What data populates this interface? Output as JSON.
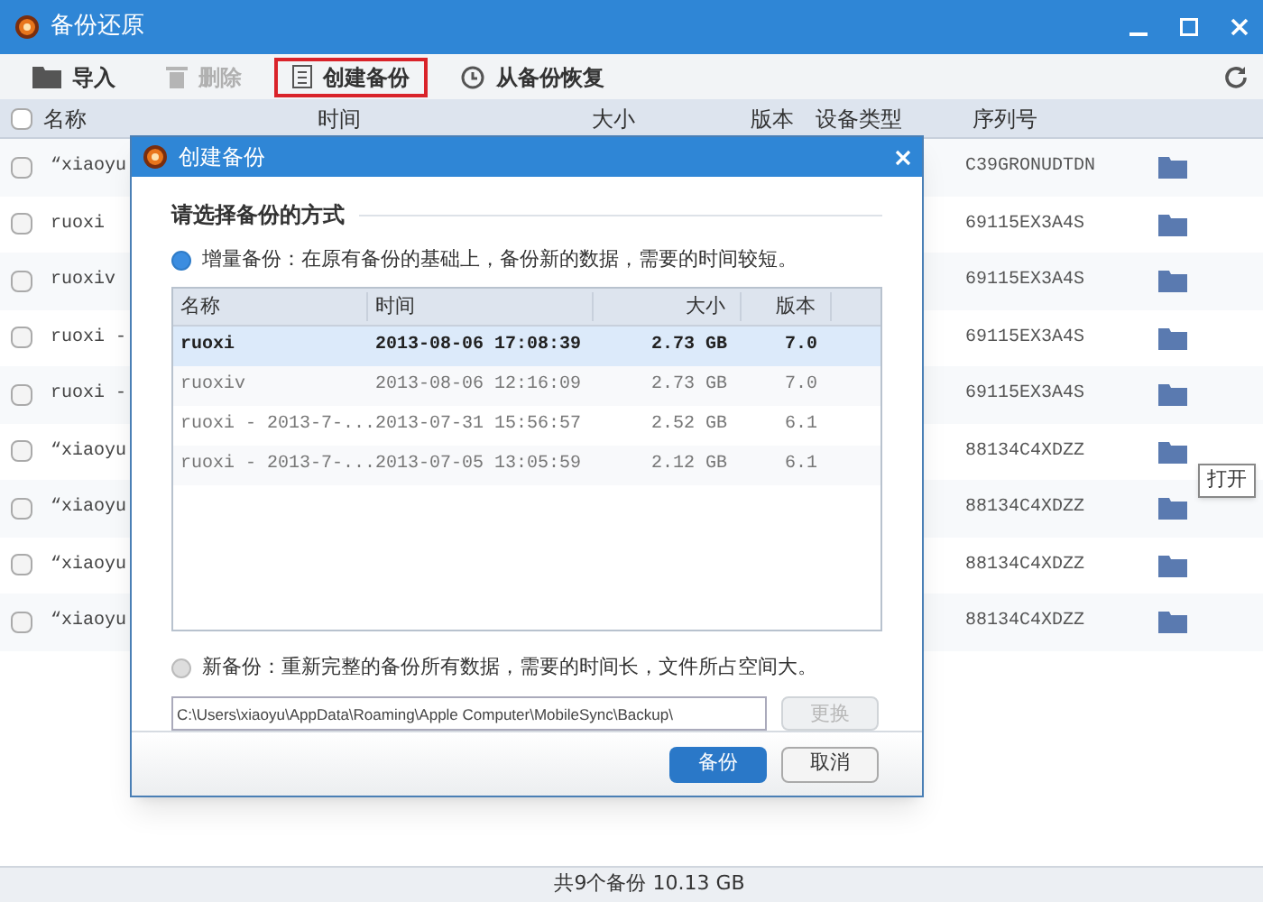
{
  "window": {
    "title": "备份还原"
  },
  "toolbar": [
    {
      "label": "导入",
      "kind": "import",
      "disabled": false,
      "highlighted": false
    },
    {
      "label": "删除",
      "kind": "delete",
      "disabled": true,
      "highlighted": false
    },
    {
      "label": "创建备份",
      "kind": "create",
      "disabled": false,
      "highlighted": true
    },
    {
      "label": "从备份恢复",
      "kind": "restore",
      "disabled": false,
      "highlighted": false
    }
  ],
  "table": {
    "all_checked": false,
    "columns": [
      "名称",
      "时间",
      "大小",
      "版本",
      "设备类型",
      "序列号"
    ],
    "rows": [
      {
        "name": "“xiaoyu",
        "serial": "C39GRONUDTDN",
        "checked": false
      },
      {
        "name": "ruoxi",
        "serial": "69115EX3A4S",
        "checked": false
      },
      {
        "name": "ruoxiv",
        "serial": "69115EX3A4S",
        "checked": false
      },
      {
        "name": "ruoxi -",
        "serial": "69115EX3A4S",
        "checked": false
      },
      {
        "name": "ruoxi -",
        "serial": "69115EX3A4S",
        "checked": false
      },
      {
        "name": "“xiaoyu",
        "serial": "88134C4XDZZ",
        "checked": false
      },
      {
        "name": "“xiaoyu",
        "serial": "88134C4XDZZ",
        "checked": false
      },
      {
        "name": "“xiaoyu",
        "serial": "88134C4XDZZ",
        "checked": false
      },
      {
        "name": "“xiaoyu",
        "serial": "88134C4XDZZ",
        "checked": false
      }
    ]
  },
  "tooltip": "打开",
  "status_bar": "共9个备份 10.13 GB",
  "dialog": {
    "title": "创建备份",
    "heading": "请选择备份的方式",
    "options": [
      {
        "label": "增量备份：在原有备份的基础上，备份新的数据，需要的时间较短。",
        "selected": true
      },
      {
        "label": "新备份：重新完整的备份所有数据，需要的时间长，文件所占空间大。",
        "selected": false
      }
    ],
    "columns": [
      "名称",
      "时间",
      "大小",
      "版本"
    ],
    "rows": [
      {
        "name": "ruoxi",
        "time": "2013-08-06 17:08:39",
        "size": "2.73 GB",
        "version": "7.0",
        "selected": true
      },
      {
        "name": "ruoxiv",
        "time": "2013-08-06 12:16:09",
        "size": "2.73 GB",
        "version": "7.0",
        "selected": false
      },
      {
        "name": "ruoxi - 2013-7-...",
        "time": "2013-07-31 15:56:57",
        "size": "2.52 GB",
        "version": "6.1",
        "selected": false
      },
      {
        "name": "ruoxi - 2013-7-...",
        "time": "2013-07-05 13:05:59",
        "size": "2.12 GB",
        "version": "6.1",
        "selected": false
      }
    ],
    "path": "C:\\Users\\xiaoyu\\AppData\\Roaming\\Apple Computer\\MobileSync\\Backup\\",
    "change_button": {
      "label": "更换",
      "disabled": true
    },
    "buttons": [
      "备份",
      "取消"
    ]
  }
}
